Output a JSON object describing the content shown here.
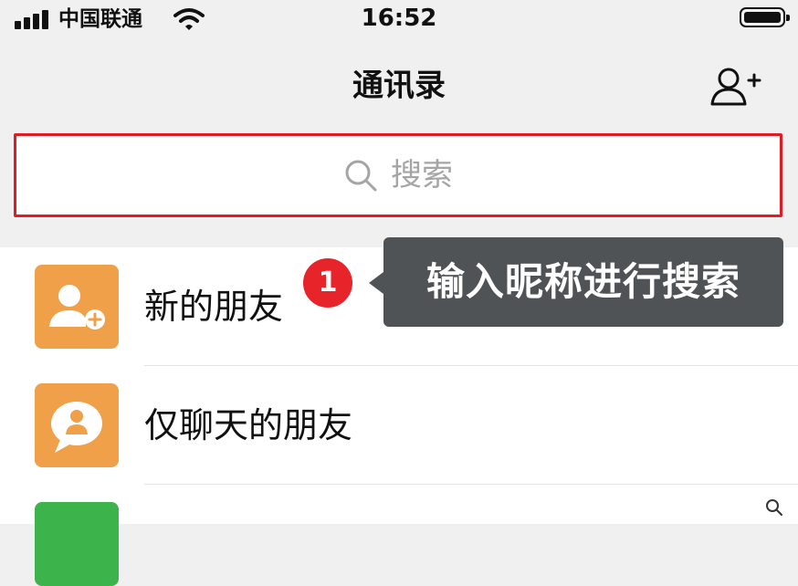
{
  "status_bar": {
    "carrier": "中国联通",
    "time": "16:52"
  },
  "nav": {
    "title": "通讯录",
    "add_icon": "add-contact-icon"
  },
  "search": {
    "placeholder": "搜索",
    "highlight_color": "#e01b24"
  },
  "list": {
    "items": [
      {
        "label": "新的朋友",
        "icon": "new-friend-icon",
        "color": "#f0a048"
      },
      {
        "label": "仅聊天的朋友",
        "icon": "chat-only-friend-icon",
        "color": "#f0a048"
      },
      {
        "label": "",
        "icon": "group-chat-icon",
        "color": "#3cb44b"
      }
    ]
  },
  "annotation": {
    "badge": "1",
    "text": "输入昵称进行搜索",
    "badge_color": "#e8242b",
    "tooltip_color": "#505356"
  },
  "index_bar": {
    "icon": "search-icon"
  }
}
